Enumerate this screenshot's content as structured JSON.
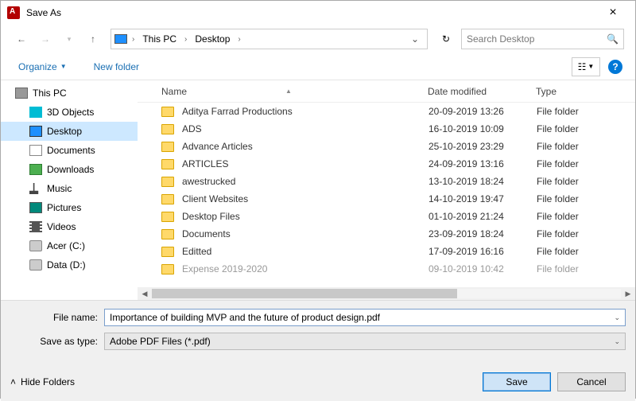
{
  "window": {
    "title": "Save As"
  },
  "breadcrumb": {
    "root": "This PC",
    "current": "Desktop"
  },
  "search": {
    "placeholder": "Search Desktop"
  },
  "toolbar": {
    "organize": "Organize",
    "new_folder": "New folder"
  },
  "columns": {
    "name": "Name",
    "date": "Date modified",
    "type": "Type"
  },
  "tree": {
    "this_pc": "This PC",
    "objects3d": "3D Objects",
    "desktop": "Desktop",
    "documents": "Documents",
    "downloads": "Downloads",
    "music": "Music",
    "pictures": "Pictures",
    "videos": "Videos",
    "acer": "Acer (C:)",
    "data": "Data (D:)"
  },
  "files": [
    {
      "name": "Aditya Farrad Productions",
      "date": "20-09-2019 13:26",
      "type": "File folder"
    },
    {
      "name": "ADS",
      "date": "16-10-2019 10:09",
      "type": "File folder"
    },
    {
      "name": "Advance Articles",
      "date": "25-10-2019 23:29",
      "type": "File folder"
    },
    {
      "name": "ARTICLES",
      "date": "24-09-2019 13:16",
      "type": "File folder"
    },
    {
      "name": "awestrucked",
      "date": "13-10-2019 18:24",
      "type": "File folder"
    },
    {
      "name": "Client Websites",
      "date": "14-10-2019 19:47",
      "type": "File folder"
    },
    {
      "name": "Desktop Files",
      "date": "01-10-2019 21:24",
      "type": "File folder"
    },
    {
      "name": "Documents",
      "date": "23-09-2019 18:24",
      "type": "File folder"
    },
    {
      "name": "Editted",
      "date": "17-09-2019 16:16",
      "type": "File folder"
    },
    {
      "name": "Expense 2019-2020",
      "date": "09-10-2019 10:42",
      "type": "File folder"
    }
  ],
  "form": {
    "file_name_label": "File name:",
    "file_name_value": "Importance of building MVP and the future of product design.pdf",
    "save_type_label": "Save as type:",
    "save_type_value": "Adobe PDF Files (*.pdf)"
  },
  "footer": {
    "hide_folders": "Hide Folders",
    "save": "Save",
    "cancel": "Cancel"
  }
}
